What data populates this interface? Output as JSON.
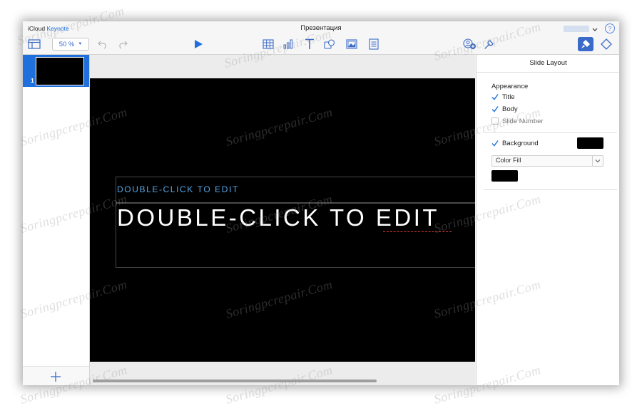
{
  "window": {
    "brand_prefix": "iCloud",
    "brand_app": "Keynote",
    "document_title": "Презентация",
    "help_glyph": "?"
  },
  "toolbar": {
    "zoom_value": "50 %",
    "icons": [
      "sidebar-icon",
      "undo-icon",
      "redo-icon",
      "play-icon",
      "table-icon",
      "chart-icon",
      "text-icon",
      "shape-icon",
      "image-icon",
      "comment-icon",
      "collaborate-icon",
      "wrench-icon",
      "format-brush-icon",
      "animate-diamond-icon"
    ]
  },
  "slides": {
    "items": [
      {
        "number": "1"
      }
    ]
  },
  "slide": {
    "subtitle_placeholder": "DOUBLE-CLICK TO EDIT",
    "title_placeholder": "DOUBLE-CLICK TO EDIT",
    "background_color": "#000000",
    "subtitle_color": "#57a7e6",
    "title_color": "#ffffff"
  },
  "inspector": {
    "header": "Slide Layout",
    "appearance_label": "Appearance",
    "appearance_options": [
      {
        "label": "Title",
        "checked": true
      },
      {
        "label": "Body",
        "checked": true
      },
      {
        "label": "Slide Number",
        "checked": false
      }
    ],
    "background": {
      "label": "Background",
      "checked": true,
      "color": "#000000"
    },
    "fill_type": "Color Fill",
    "fill_color": "#000000"
  },
  "accent_color": "#3a6bc8",
  "watermark": "Soringpcrepair.Com"
}
